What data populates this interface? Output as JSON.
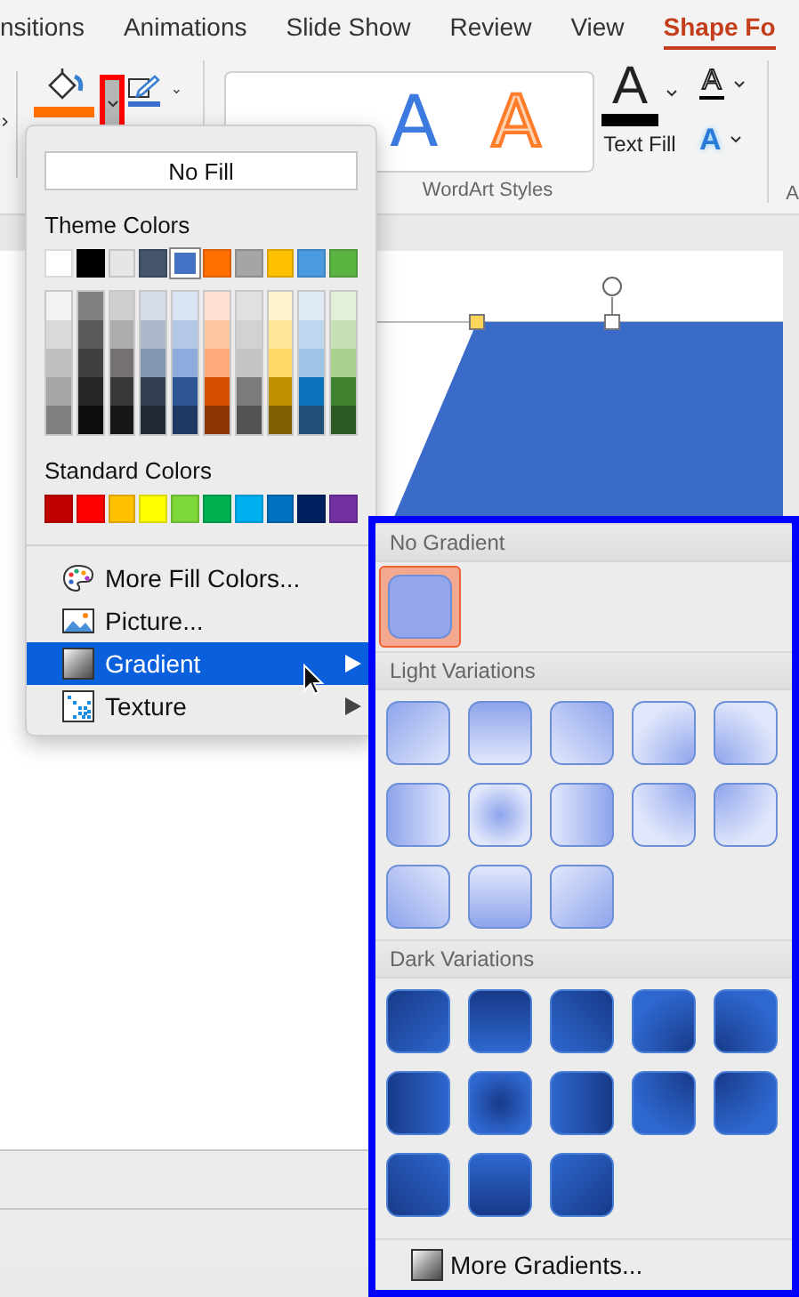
{
  "tabs": [
    {
      "label": "nsitions",
      "selected": false
    },
    {
      "label": "Animations",
      "selected": false
    },
    {
      "label": "Slide Show",
      "selected": false
    },
    {
      "label": "Review",
      "selected": false
    },
    {
      "label": "View",
      "selected": false
    },
    {
      "label": "Shape Fo",
      "selected": true
    }
  ],
  "ribbon": {
    "fill_caret": {
      "highlighted": true
    },
    "wordart": {
      "samples": [
        {
          "letter": "A",
          "kind": "solid-blue"
        },
        {
          "letter": "A",
          "kind": "outline-orange"
        }
      ],
      "label": "WordArt Styles"
    },
    "text_fill": {
      "letter": "A",
      "label": "Text Fill"
    },
    "text_outline": {
      "letter": "A"
    },
    "text_effects": {
      "letter": "A"
    },
    "next_group_label": "A"
  },
  "fill_menu": {
    "no_fill": "No Fill",
    "theme_title": "Theme Colors",
    "theme_colors": [
      {
        "color": "#ffffff",
        "selected": false,
        "shades": [
          {
            "color": "#f2f2f2"
          },
          {
            "color": "#d9d9d9"
          },
          {
            "color": "#bfbfbf"
          },
          {
            "color": "#a6a6a6"
          },
          {
            "color": "#808080"
          }
        ]
      },
      {
        "color": "#000000",
        "selected": false,
        "shades": [
          {
            "color": "#808080"
          },
          {
            "color": "#595959"
          },
          {
            "color": "#404040"
          },
          {
            "color": "#262626"
          },
          {
            "color": "#0d0d0d"
          }
        ]
      },
      {
        "color": "#e7e6e6",
        "selected": false,
        "shades": [
          {
            "color": "#d0cece"
          },
          {
            "color": "#aeabab"
          },
          {
            "color": "#757171"
          },
          {
            "color": "#3b3838"
          },
          {
            "color": "#171616"
          }
        ]
      },
      {
        "color": "#44546a",
        "selected": false,
        "shades": [
          {
            "color": "#d6dce5"
          },
          {
            "color": "#adb9ca"
          },
          {
            "color": "#8497b0"
          },
          {
            "color": "#333f50"
          },
          {
            "color": "#222a35"
          }
        ]
      },
      {
        "color": "#4472c4",
        "selected": true,
        "shades": [
          {
            "color": "#dae3f3"
          },
          {
            "color": "#b4c7e7"
          },
          {
            "color": "#8faadc"
          },
          {
            "color": "#2f5597"
          },
          {
            "color": "#1f3864"
          }
        ]
      },
      {
        "color": "#ff7000",
        "selected": false,
        "shades": [
          {
            "color": "#ffe0d0"
          },
          {
            "color": "#ffc8a0"
          },
          {
            "color": "#ffaa78"
          },
          {
            "color": "#d45000"
          },
          {
            "color": "#8c3500"
          }
        ]
      },
      {
        "color": "#a5a5a5",
        "selected": false,
        "shades": [
          {
            "color": "#e0e0e0"
          },
          {
            "color": "#d2d2d2"
          },
          {
            "color": "#c4c4c4"
          },
          {
            "color": "#7b7b7b"
          },
          {
            "color": "#525252"
          }
        ]
      },
      {
        "color": "#ffc000",
        "selected": false,
        "shades": [
          {
            "color": "#fff2cc"
          },
          {
            "color": "#ffe699"
          },
          {
            "color": "#ffd966"
          },
          {
            "color": "#bf9000"
          },
          {
            "color": "#7f6000"
          }
        ]
      },
      {
        "color": "#4a9be0",
        "selected": false,
        "shades": [
          {
            "color": "#deebf7"
          },
          {
            "color": "#bdd7ee"
          },
          {
            "color": "#9dc3e6"
          },
          {
            "color": "#0a72bb"
          },
          {
            "color": "#1f4e79"
          }
        ]
      },
      {
        "color": "#5bb342",
        "selected": false,
        "shades": [
          {
            "color": "#e2f0d9"
          },
          {
            "color": "#c5e0b4"
          },
          {
            "color": "#a9d18e"
          },
          {
            "color": "#3f8230"
          },
          {
            "color": "#2c5a22"
          }
        ]
      }
    ],
    "standard_title": "Standard Colors",
    "standard_colors": [
      {
        "color": "#c00000",
        "selected": false
      },
      {
        "color": "#ff0000",
        "selected": false
      },
      {
        "color": "#ffc000",
        "selected": false
      },
      {
        "color": "#ffff00",
        "selected": false
      },
      {
        "color": "#7ed83c",
        "selected": false
      },
      {
        "color": "#00b050",
        "selected": false
      },
      {
        "color": "#00b0f0",
        "selected": false
      },
      {
        "color": "#0070c0",
        "selected": false
      },
      {
        "color": "#002060",
        "selected": false
      },
      {
        "color": "#7030a0",
        "selected": false
      }
    ],
    "items": [
      {
        "label": "More Fill Colors...",
        "kind": "palette",
        "selected": false,
        "submenu": false
      },
      {
        "label": "Picture...",
        "kind": "picture",
        "selected": false,
        "submenu": false
      },
      {
        "label": "Gradient",
        "kind": "gradient",
        "selected": true,
        "submenu": true
      },
      {
        "label": "Texture",
        "kind": "texture",
        "selected": false,
        "submenu": true
      }
    ]
  },
  "gradient_menu": {
    "sections": [
      {
        "title": "No Gradient",
        "kind": "none",
        "swatches": [
          {
            "kind": "flat",
            "selected": true
          }
        ]
      },
      {
        "title": "Light Variations",
        "kind": "light",
        "swatches": [
          {
            "kind": "diag-tl",
            "selected": false
          },
          {
            "kind": "top",
            "selected": false
          },
          {
            "kind": "diag-tr",
            "selected": false
          },
          {
            "kind": "corner-br",
            "selected": false
          },
          {
            "kind": "corner-bl",
            "selected": false
          },
          {
            "kind": "left",
            "selected": false
          },
          {
            "kind": "center",
            "selected": false
          },
          {
            "kind": "right",
            "selected": false
          },
          {
            "kind": "corner-tr",
            "selected": false
          },
          {
            "kind": "corner-tl",
            "selected": false
          },
          {
            "kind": "diag-bl",
            "selected": false
          },
          {
            "kind": "bottom",
            "selected": false
          },
          {
            "kind": "diag-br",
            "selected": false
          }
        ]
      },
      {
        "title": "Dark Variations",
        "kind": "dark",
        "swatches": [
          {
            "kind": "diag-tl",
            "selected": false
          },
          {
            "kind": "top",
            "selected": false
          },
          {
            "kind": "diag-tr",
            "selected": false
          },
          {
            "kind": "corner-br",
            "selected": false
          },
          {
            "kind": "corner-bl",
            "selected": false
          },
          {
            "kind": "left",
            "selected": false
          },
          {
            "kind": "center",
            "selected": false
          },
          {
            "kind": "right",
            "selected": false
          },
          {
            "kind": "corner-tr",
            "selected": false
          },
          {
            "kind": "corner-tl",
            "selected": false
          },
          {
            "kind": "diag-bl",
            "selected": false
          },
          {
            "kind": "bottom",
            "selected": false
          },
          {
            "kind": "diag-br",
            "selected": false
          }
        ]
      }
    ],
    "more": "More Gradients..."
  }
}
